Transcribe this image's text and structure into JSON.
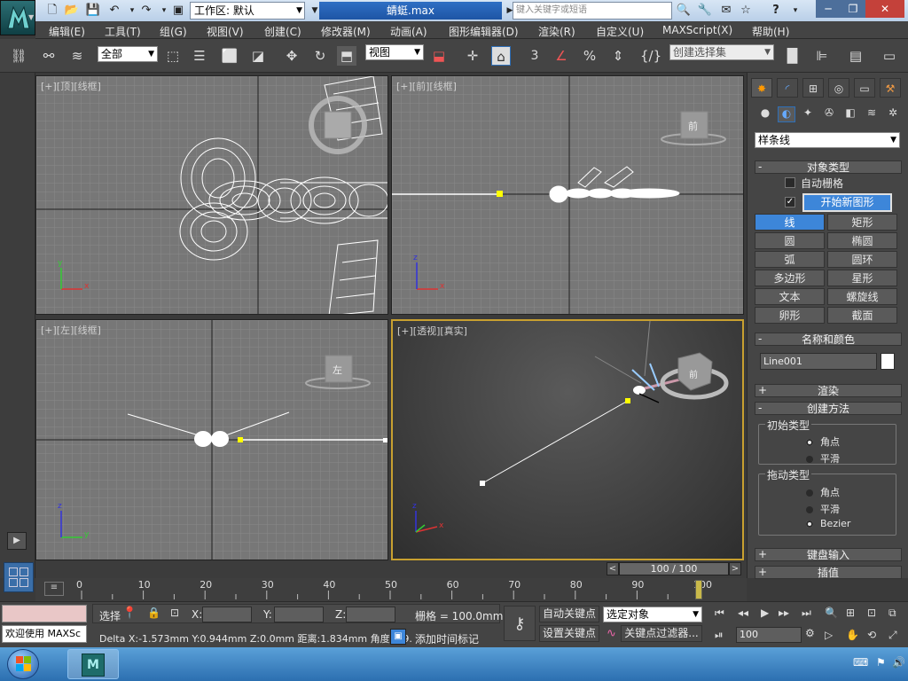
{
  "titlebar": {
    "workspace_label": "工作区: 默认",
    "file_title": "蜻蜓.max",
    "search_placeholder": "键入关键字或短语"
  },
  "menu": [
    "编辑(E)",
    "工具(T)",
    "组(G)",
    "视图(V)",
    "创建(C)",
    "修改器(M)",
    "动画(A)",
    "图形编辑器(D)",
    "渲染(R)",
    "自定义(U)",
    "MAXScript(X)",
    "帮助(H)"
  ],
  "toolbar": {
    "filter_select": "全部",
    "ref_coord_select": "视图",
    "snap_label": "3",
    "selection_set_placeholder": "创建选择集"
  },
  "viewports": {
    "top": {
      "label": "[+][顶][线框]",
      "cube": "",
      "axis_x": "x",
      "axis_y": "y"
    },
    "front": {
      "label": "[+][前][线框]",
      "cube": "前",
      "axis_x": "x",
      "axis_y": "z"
    },
    "left": {
      "label": "[+][左][线框]",
      "cube": "左",
      "axis_x": "y",
      "axis_y": "z"
    },
    "perspective": {
      "label": "[+][透视][真实]",
      "cube": "前",
      "axis_x": "x",
      "axis_y": "z"
    }
  },
  "panel": {
    "category_select": "样条线",
    "object_type": {
      "title": "对象类型",
      "autogrid_label": "自动栅格",
      "start_new_shape_label": "开始新图形",
      "start_new_shape_checked": true,
      "buttons": [
        {
          "label": "线",
          "active": true
        },
        {
          "label": "矩形",
          "active": false
        },
        {
          "label": "圆",
          "active": false
        },
        {
          "label": "椭圆",
          "active": false
        },
        {
          "label": "弧",
          "active": false
        },
        {
          "label": "圆环",
          "active": false
        },
        {
          "label": "多边形",
          "active": false
        },
        {
          "label": "星形",
          "active": false
        },
        {
          "label": "文本",
          "active": false
        },
        {
          "label": "螺旋线",
          "active": false
        },
        {
          "label": "卵形",
          "active": false
        },
        {
          "label": "截面",
          "active": false
        }
      ]
    },
    "name_color": {
      "title": "名称和颜色",
      "name_value": "Line001",
      "color": "#ffffff"
    },
    "render": {
      "title": "渲染"
    },
    "creation_method": {
      "title": "创建方法",
      "initial_type": {
        "title": "初始类型",
        "options": [
          "角点",
          "平滑"
        ],
        "selected": "角点"
      },
      "drag_type": {
        "title": "拖动类型",
        "options": [
          "角点",
          "平滑",
          "Bezier"
        ],
        "selected": "Bezier"
      }
    },
    "keyboard_entry": {
      "title": "键盘输入"
    },
    "interpolation": {
      "title": "插值"
    }
  },
  "timeline": {
    "frame_display": "100 / 100",
    "current_frame": 100,
    "total_frames": 100,
    "ticks": [
      "0",
      "10",
      "20",
      "30",
      "40",
      "50",
      "60",
      "70",
      "80",
      "90",
      "100"
    ]
  },
  "status": {
    "welcome": "欢迎使用 MAXSc",
    "select_label": "选择",
    "x_label": "X:",
    "y_label": "Y:",
    "z_label": "Z:",
    "grid_label": "栅格 = 100.0mm",
    "delta": "Delta X:-1.573mm  Y:0.944mm  Z:0.0mm  距离:1.834mm 角度:-59.",
    "add_time_tag": "添加时间标记",
    "auto_key": "自动关键点",
    "set_key": "设置关键点",
    "key_mode_select": "选定对象",
    "key_filters": "关键点过滤器...",
    "frame_field": "100"
  },
  "colors": {
    "accent": "#3d86d9",
    "viewport_bg": "#777777",
    "active_border": "#c8a030"
  }
}
